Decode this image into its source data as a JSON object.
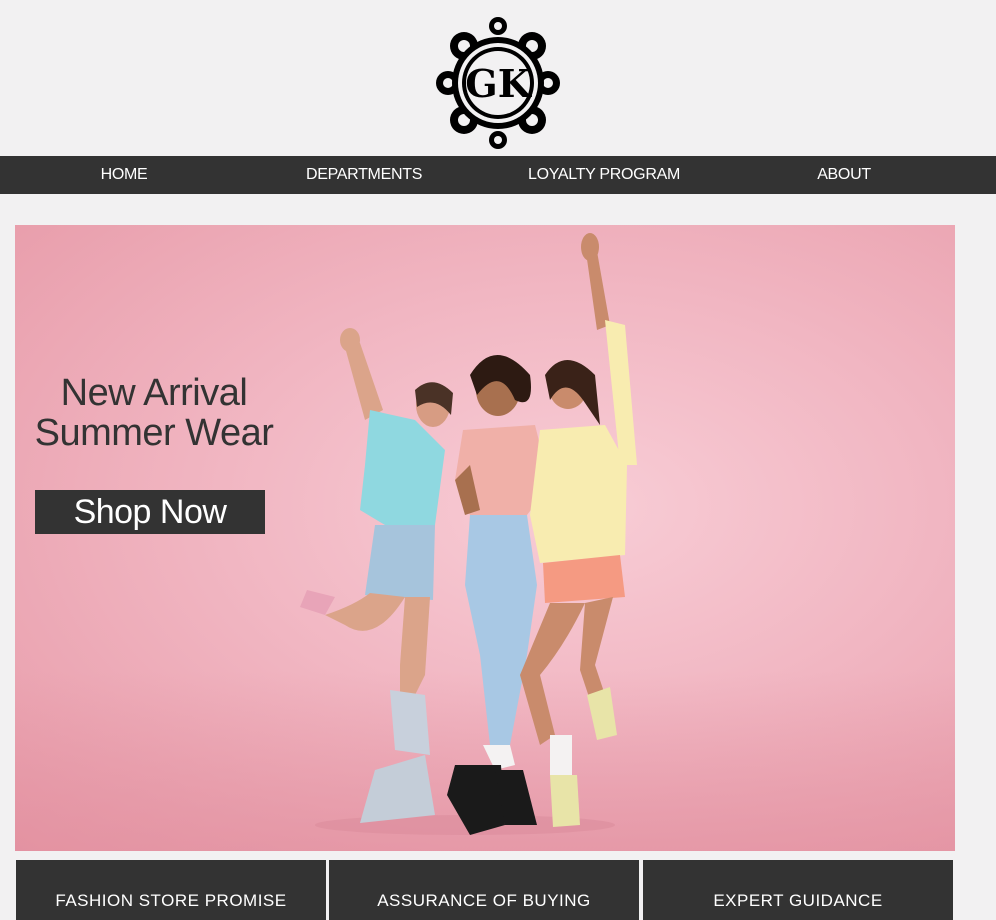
{
  "brand": {
    "logo_text": "GK"
  },
  "nav": {
    "items": [
      {
        "label": "HOME"
      },
      {
        "label": "DEPARTMENTS"
      },
      {
        "label": "LOYALTY PROGRAM"
      },
      {
        "label": "ABOUT"
      }
    ]
  },
  "hero": {
    "title_line1": "New Arrival",
    "title_line2": "Summer Wear",
    "cta_label": "Shop Now"
  },
  "features": [
    {
      "label": "FASHION STORE PROMISE"
    },
    {
      "label": "ASSURANCE OF BUYING"
    },
    {
      "label": "EXPERT GUIDANCE"
    }
  ],
  "colors": {
    "page_bg": "#f2f1f2",
    "nav_bg": "#333333",
    "hero_bg": "#f1b6c2",
    "text_dark": "#333333"
  }
}
